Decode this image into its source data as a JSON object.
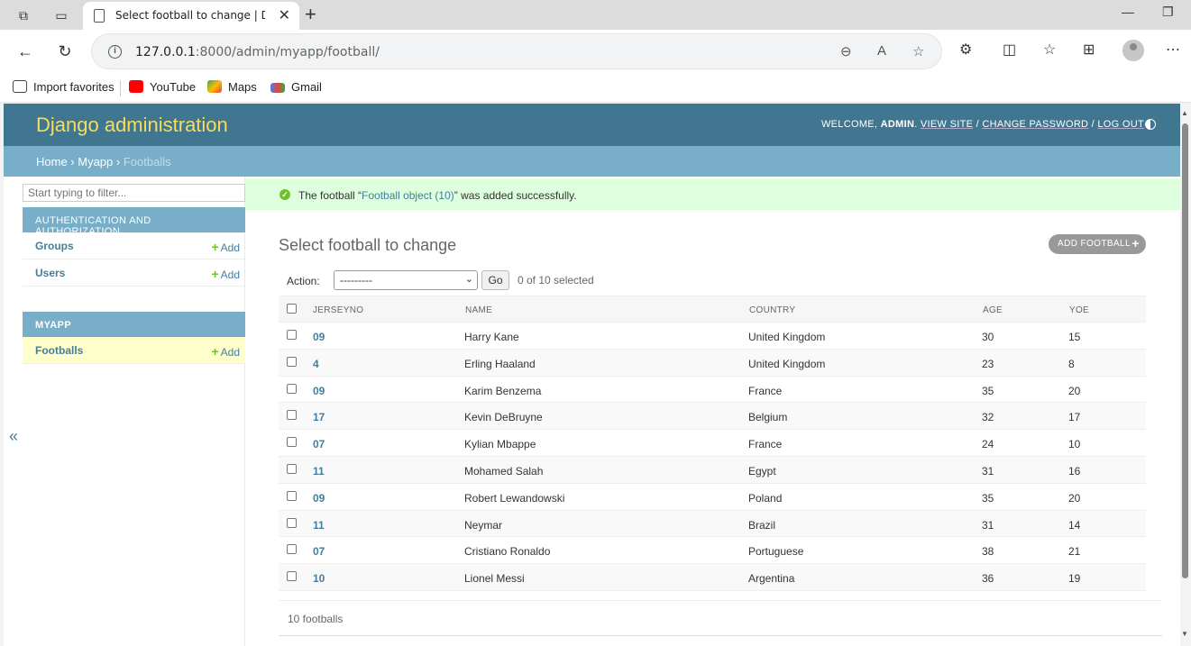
{
  "browser": {
    "tab_title": "Select football to change | Django",
    "url_host": "127.0.0.1",
    "url_path": ":8000/admin/myapp/football/",
    "bookmarks": [
      "Import favorites",
      "YouTube",
      "Maps",
      "Gmail"
    ]
  },
  "header": {
    "brand": "Django administration",
    "welcome": "WELCOME,",
    "user": "ADMIN",
    "view_site": "VIEW SITE",
    "change_password": "CHANGE PASSWORD",
    "log_out": "LOG OUT"
  },
  "breadcrumbs": {
    "home": "Home",
    "app": "Myapp",
    "current": "Footballs"
  },
  "sidebar": {
    "filter_placeholder": "Start typing to filter...",
    "auth_caption": "AUTHENTICATION AND AUTHORIZATION",
    "groups": "Groups",
    "users": "Users",
    "add": "Add",
    "app_caption": "MYAPP",
    "footballs": "Footballs"
  },
  "message": {
    "prefix": "The football “",
    "object": "Football object (10)",
    "suffix": "” was added successfully."
  },
  "content": {
    "title": "Select football to change",
    "add_button": "ADD FOOTBALL",
    "action_label": "Action:",
    "action_value": "---------",
    "go": "Go",
    "selected": "0 of 10 selected",
    "columns": [
      "JERSEYNO",
      "NAME",
      "COUNTRY",
      "AGE",
      "YOE"
    ],
    "rows": [
      [
        "09",
        "Harry Kane",
        "United Kingdom",
        "30",
        "15"
      ],
      [
        "4",
        "Erling Haaland",
        "United Kingdom",
        "23",
        "8"
      ],
      [
        "09",
        "Karim Benzema",
        "France",
        "35",
        "20"
      ],
      [
        "17",
        "Kevin DeBruyne",
        "Belgium",
        "32",
        "17"
      ],
      [
        "07",
        "Kylian Mbappe",
        "France",
        "24",
        "10"
      ],
      [
        "11",
        "Mohamed Salah",
        "Egypt",
        "31",
        "16"
      ],
      [
        "09",
        "Robert Lewandowski",
        "Poland",
        "35",
        "20"
      ],
      [
        "11",
        "Neymar",
        "Brazil",
        "31",
        "14"
      ],
      [
        "07",
        "Cristiano Ronaldo",
        "Portuguese",
        "38",
        "21"
      ],
      [
        "10",
        "Lionel Messi",
        "Argentina",
        "36",
        "19"
      ]
    ],
    "footer": "10 footballs"
  },
  "colors": {
    "header": "#417690",
    "brand": "#f5dd5d",
    "breadcrumbs": "#79aec8",
    "link": "#447e9b",
    "success": "#dfd"
  }
}
